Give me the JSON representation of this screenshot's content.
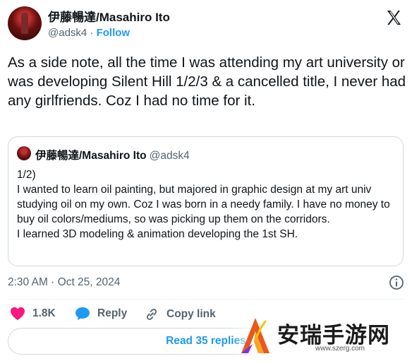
{
  "author": {
    "display_name": "伊藤暢達/Masahiro Ito",
    "handle": "@adsk4",
    "separator": "·",
    "follow_label": "Follow"
  },
  "tweet": {
    "text": "As a side note, all the time I was attending my art university or was developing Silent Hill 1/2/3 & a cancelled title, I never had any girlfriends. Coz I had no time for it."
  },
  "quoted": {
    "display_name": "伊藤暢達/Masahiro Ito",
    "handle": "@adsk4",
    "lines": [
      "1/2)",
      "I wanted to learn oil painting, but majored in graphic design at my art univ studying oil on my own. Coz I was born in a needy family. I have no money to buy oil colors/mediums, so was picking up them on the corridors.",
      "I learned 3D modeling & animation developing the 1st SH."
    ]
  },
  "meta": {
    "timestamp": "2:30 AM · Oct 25, 2024"
  },
  "actions": {
    "likes": "1.8K",
    "reply_label": "Reply",
    "copy_label": "Copy link"
  },
  "replies": {
    "label": "Read 35 replies"
  },
  "watermark": {
    "title": "安瑞手游网",
    "url": "www.szerg.com"
  },
  "colors": {
    "accent": "#1d9bf0",
    "like": "#f91880",
    "text": "#0f1419",
    "muted": "#536471"
  },
  "icons": [
    "x-logo-icon",
    "info-icon",
    "heart-icon",
    "reply-icon",
    "link-icon"
  ]
}
